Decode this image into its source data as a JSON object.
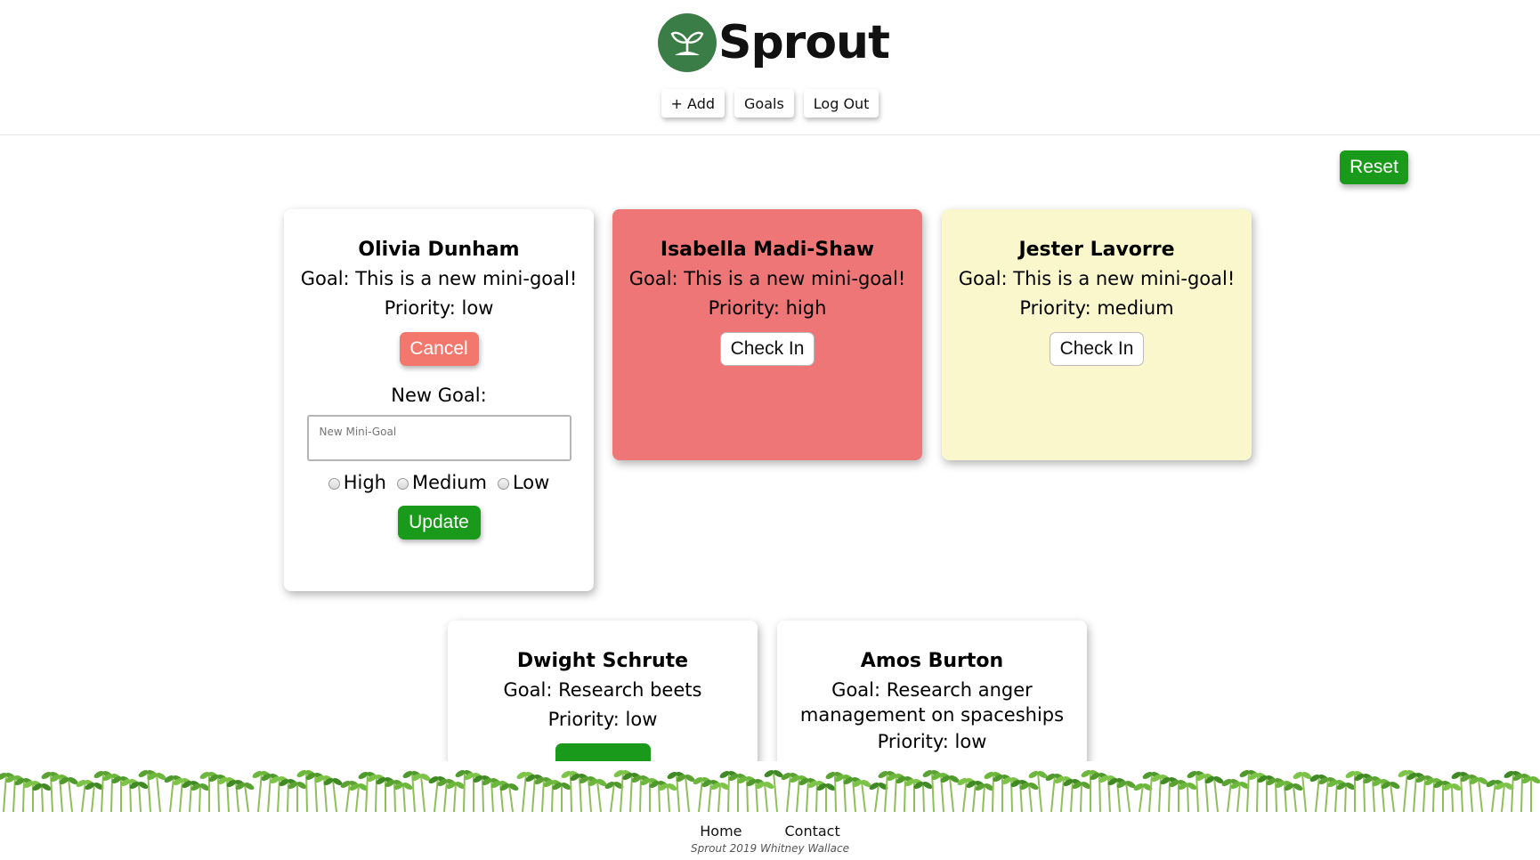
{
  "app": {
    "name": "Sprout",
    "logo_icon": "seedling-icon",
    "brand_color": "#3b7d47"
  },
  "nav": {
    "add_label": "+ Add",
    "goals_label": "Goals",
    "logout_label": "Log Out"
  },
  "toolbar": {
    "reset_label": "Reset",
    "reset_color": "#1a9a1a"
  },
  "cards": [
    {
      "name": "Olivia Dunham",
      "goal": "Goal: This is a new mini-goal!",
      "priority": "Priority: low",
      "color": "#ffffff",
      "editing": true,
      "cancel_label": "Cancel",
      "new_goal_label": "New Goal:",
      "new_goal_placeholder": "New Mini-Goal",
      "radio_high": "High",
      "radio_medium": "Medium",
      "radio_low": "Low",
      "update_label": "Update"
    },
    {
      "name": "Isabella Madi-Shaw",
      "goal": "Goal: This is a new mini-goal!",
      "priority": "Priority: high",
      "color": "#ee7676",
      "checkin_label": "Check In"
    },
    {
      "name": "Jester Lavorre",
      "goal": "Goal: This is a new mini-goal!",
      "priority": "Priority: medium",
      "color": "#f9f7cb",
      "checkin_label": "Check In"
    },
    {
      "name": "Dwight Schrute",
      "goal": "Goal: Research beets",
      "priority": "Priority: low",
      "color": "#ffffff"
    },
    {
      "name": "Amos Burton",
      "goal": "Goal: Research anger management on spaceships",
      "priority": "Priority: low",
      "color": "#ffffff"
    }
  ],
  "footer": {
    "home_label": "Home",
    "contact_label": "Contact",
    "copyright": "Sprout 2019 Whitney Wallace"
  }
}
